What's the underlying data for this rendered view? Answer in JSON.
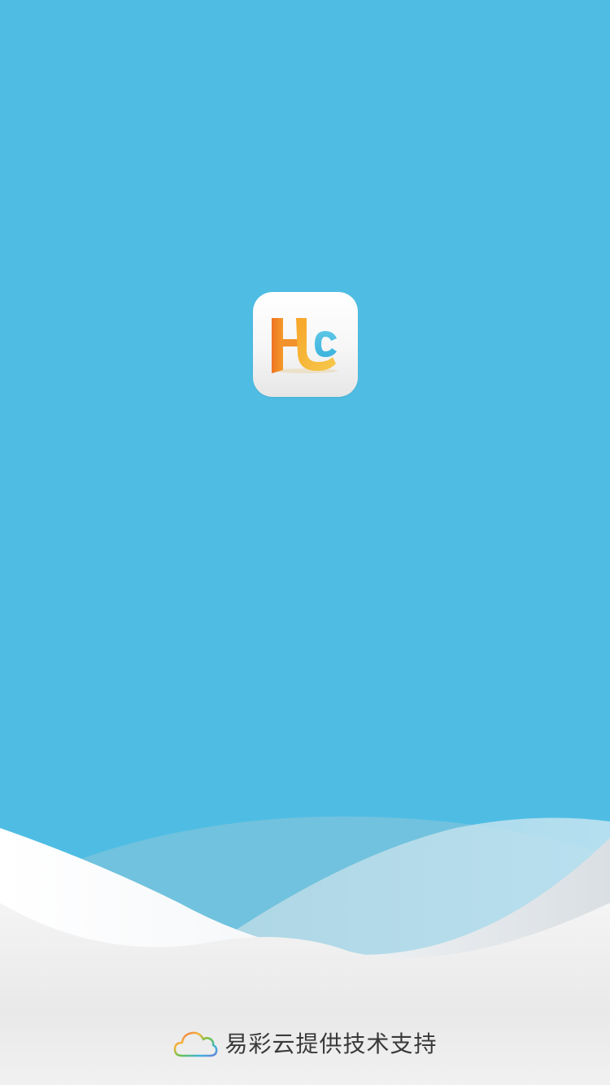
{
  "splash": {
    "background_color": "#4FBDE3",
    "app_icon": {
      "icon": "hc-logo-icon",
      "colors": {
        "orange": "#EE7A22",
        "yellow": "#F3B43A",
        "blue": "#4FBDE3"
      }
    },
    "footer": {
      "icon": "rainbow-cloud-icon",
      "text": "易彩云提供技术支持"
    }
  }
}
